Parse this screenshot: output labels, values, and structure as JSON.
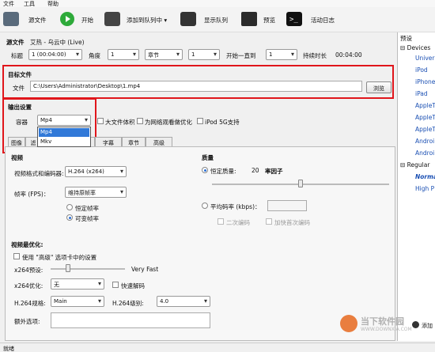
{
  "menu": {
    "file": "文件",
    "tools": "工具",
    "help": "帮助"
  },
  "toolbar": {
    "source": "源文件",
    "start": "开始",
    "add_to_queue": "添加到队列中 ▾",
    "show_queue": "显示队列",
    "preview": "预览",
    "activity_log": "活动日志"
  },
  "source": {
    "label": "源文件",
    "name": "艾热 - 乌云中 (Live)",
    "title_label": "标题",
    "title_value": "1 (00:04:00)",
    "angle_label": "角度",
    "angle_value": "1",
    "chapters_label": "章节",
    "chapter_start": "1",
    "from_to": "开始一直到",
    "chapter_end": "1",
    "duration_label": "持续时长",
    "duration_value": "00:04:00"
  },
  "destination": {
    "section": "目标文件",
    "file_label": "文件",
    "file_value": "C:\\Users\\Administrator\\Desktop\\1.mp4",
    "browse": "浏览"
  },
  "output": {
    "section": "输出设置",
    "container_label": "容器",
    "container_value": "Mp4",
    "options": [
      "Mp4",
      "Mkv"
    ],
    "large_file": "大文件体积",
    "web_optimized": "为网络观看做优化",
    "ipod": "iPod 5G支持"
  },
  "tabs": [
    "图像",
    "滤",
    "",
    "",
    "字幕",
    "章节",
    "高级"
  ],
  "video": {
    "section": "视频",
    "codec_label": "视频格式和编码器:",
    "codec_value": "H.264 (x264)",
    "fps_label": "帧率 (FPS)：",
    "fps_value": "维持原帧率",
    "constant_fr": "恒定帧率",
    "variable_fr": "可变帧率"
  },
  "quality": {
    "section": "质量",
    "constant_quality": "恒定质量:",
    "cq_value": "20",
    "rf_label": "率因子",
    "avg_bitrate": "平均码率 (kbps)：",
    "two_pass": "二次编码",
    "turbo": "加快首次编码"
  },
  "optimise": {
    "section": "视频最优化:",
    "use_advanced": "使用 \"高级\" 选项卡中的设置",
    "preset_label": "x264预设:",
    "preset_value": "Very Fast",
    "tune_label": "x264优化:",
    "tune_value": "无",
    "fast_decode": "快速解码",
    "profile_label": "H.264规格:",
    "profile_value": "Main",
    "level_label": "H.264级别:",
    "level_value": "4.0",
    "extra_label": "额外选项:"
  },
  "presets": {
    "title": "预设",
    "devices": "Devices",
    "items": [
      "Univers",
      "iPod",
      "iPhone",
      "iPad",
      "AppleT",
      "AppleT",
      "AppleT",
      "Androi",
      "Androi"
    ],
    "regular": "Regular",
    "regular_items": [
      "Norma",
      "High P"
    ]
  },
  "watermark": {
    "text": "当下软件园",
    "sub": "WWW.DOWNXIA.COM",
    "add": "添加"
  },
  "status": "就绪",
  "colors": {
    "red_highlight": "#e0161b",
    "link_blue": "#1a4fb3",
    "accent_green": "#2eaa3a"
  }
}
